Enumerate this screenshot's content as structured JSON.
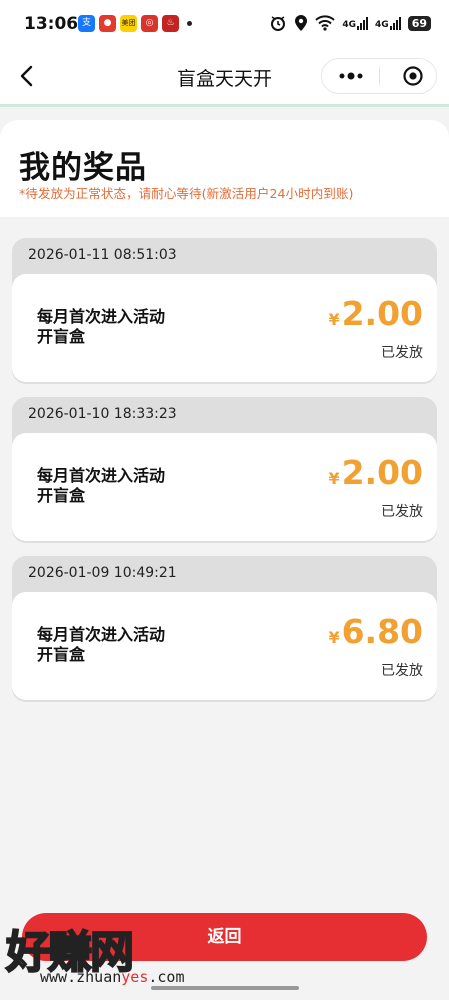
{
  "status_bar": {
    "time": "13:06",
    "battery": "69",
    "network_1": "4G",
    "network_2": "4G",
    "app_icons": [
      "alipay-icon",
      "red-envelope-icon",
      "meituan-icon",
      "app-icon",
      "taobao-icon"
    ],
    "meituan_label": "美团"
  },
  "nav": {
    "title": "盲盒天天开",
    "back_icon": "chevron-left-icon",
    "more_icon": "more-dots-icon",
    "close_icon": "target-close-icon"
  },
  "header": {
    "title": "我的奖品",
    "notice": "*待发放为正常状态，请耐心等待(新激活用户24小时内到账)"
  },
  "records": [
    {
      "date": "2026-01-11 08:51:03",
      "desc_line1": "每月首次进入活动",
      "desc_line2": "开盲盒",
      "currency": "¥",
      "amount": "2.00",
      "status": "已发放"
    },
    {
      "date": "2026-01-10 18:33:23",
      "desc_line1": "每月首次进入活动",
      "desc_line2": "开盲盒",
      "currency": "¥",
      "amount": "2.00",
      "status": "已发放"
    },
    {
      "date": "2026-01-09 10:49:21",
      "desc_line1": "每月首次进入活动",
      "desc_line2": "开盲盒",
      "currency": "¥",
      "amount": "6.80",
      "status": "已发放"
    }
  ],
  "footer": {
    "return_label": "返回",
    "watermark_text": "好赚网",
    "watermark_url_a": "www.zhuan",
    "watermark_url_b": "yes",
    "watermark_url_c": ".com"
  },
  "colors": {
    "accent": "#f0a132",
    "button": "#e62f32",
    "notice": "#e26d3a"
  }
}
